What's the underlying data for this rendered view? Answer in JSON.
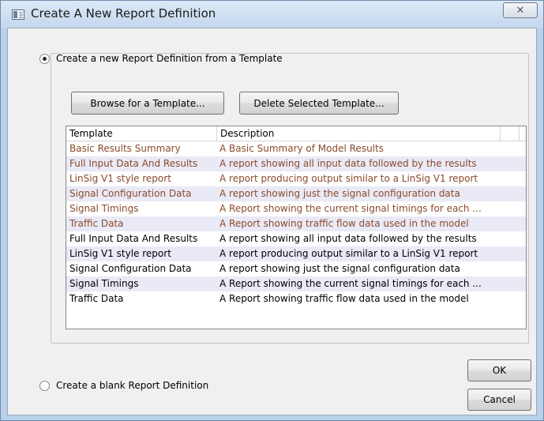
{
  "window": {
    "title": "Create A New Report Definition",
    "close_glyph": "✕"
  },
  "options": {
    "template_label": "Create a new Report Definition from a Template",
    "template_selected": true,
    "blank_label": "Create a blank Report Definition",
    "blank_selected": false
  },
  "buttons": {
    "browse": "Browse for a Template...",
    "delete": "Delete Selected Template...",
    "ok": "OK",
    "cancel": "Cancel"
  },
  "table": {
    "columns": [
      "Template",
      "Description"
    ],
    "rows": [
      {
        "template": "Basic Results Summary",
        "description": "A Basic Summary of Model Results",
        "style": "brown"
      },
      {
        "template": "Full Input Data And Results",
        "description": "A report showing all input data followed by the results",
        "style": "brown"
      },
      {
        "template": "LinSig V1 style report",
        "description": "A report producing output similar to a LinSig V1 report",
        "style": "brown"
      },
      {
        "template": "Signal Configuration Data",
        "description": "A report showing just the signal configuration data",
        "style": "brown"
      },
      {
        "template": "Signal Timings",
        "description": "A Report showing the current signal timings for each ...",
        "style": "brown"
      },
      {
        "template": "Traffic Data",
        "description": "A Report showing traffic flow data used in the model",
        "style": "brown"
      },
      {
        "template": "Full Input Data And Results",
        "description": "A report showing all input data followed by the results",
        "style": "black"
      },
      {
        "template": "LinSig V1 style report",
        "description": "A report producing output similar to a LinSig V1 report",
        "style": "black"
      },
      {
        "template": "Signal Configuration Data",
        "description": "A report showing just the signal configuration data",
        "style": "black"
      },
      {
        "template": "Signal Timings",
        "description": "A Report showing the current signal timings for each ...",
        "style": "black"
      },
      {
        "template": "Traffic Data",
        "description": "A Report showing traffic flow data used in the model",
        "style": "black"
      }
    ]
  },
  "colors": {
    "builtin_template_text": "#8a4b2a",
    "user_template_text": "#000000",
    "alt_row": "#eaeaf6"
  }
}
